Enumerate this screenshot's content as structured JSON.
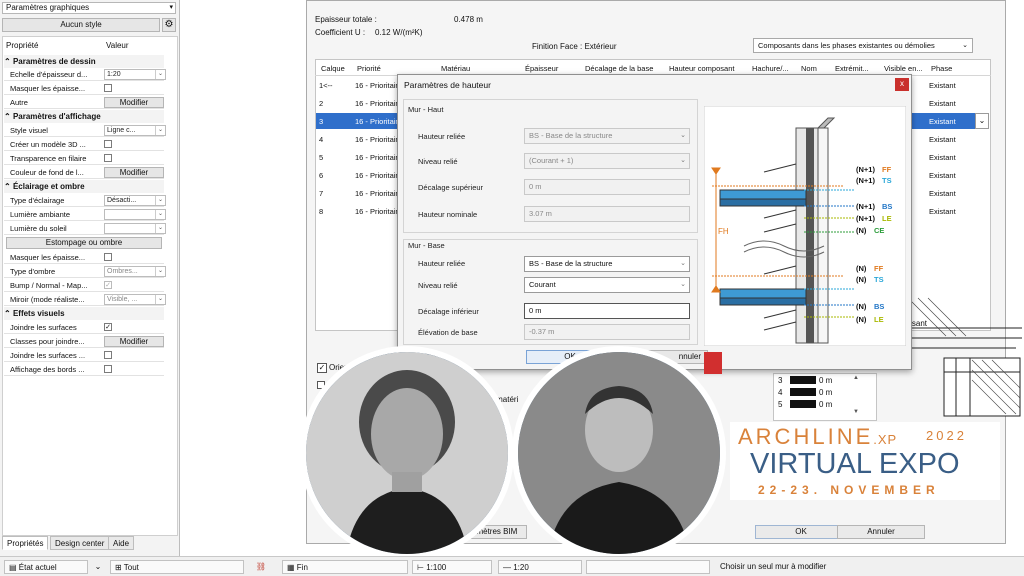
{
  "left_panel": {
    "dropdown": "Paramètres graphiques",
    "style_button": "Aucun style",
    "col_prop": "Propriété",
    "col_val": "Valeur",
    "sections": {
      "dessin": "Paramètres de dessin",
      "affichage": "Paramètres d'affichage",
      "eclairage": "Éclairage et ombre",
      "effets": "Effets visuels"
    },
    "rows": {
      "echelle": "Echelle d'épaisseur d...",
      "echelle_val": "1:20",
      "masquer1": "Masquer les épaisse...",
      "autre": "Autre",
      "modifier": "Modifier",
      "style_visuel": "Style visuel",
      "style_visuel_val": "Ligne c...",
      "creer_modele": "Créer un modèle 3D ...",
      "transparence": "Transparence en filaire",
      "couleur_fond": "Couleur de fond de l...",
      "type_eclairage": "Type d'éclairage",
      "type_eclairage_val": "Désacti...",
      "lumiere_ambiante": "Lumière ambiante",
      "lumiere_soleil": "Lumière du soleil",
      "estompage": "Estompage ou ombre",
      "masquer2": "Masquer les épaisse...",
      "type_ombre": "Type d'ombre",
      "type_ombre_val": "Ombres...",
      "bump": "Bump / Normal - Map...",
      "miroir": "Miroir (mode réaliste...",
      "miroir_val": "Visible, ...",
      "joindre": "Joindre les surfaces",
      "classes": "Classes pour joindre...",
      "joindre2": "Joindre les surfaces ...",
      "affichage_bords": "Affichage des bords ..."
    },
    "tabs": [
      "Propriétés",
      "Design center",
      "Aide"
    ]
  },
  "status_bar": {
    "etat": "État actuel",
    "tout": "Tout",
    "fin": "Fin",
    "scale1": "1:100",
    "scale2": "1:20",
    "hint": "Choisir un seul mur à modifier"
  },
  "main_dialog": {
    "epaisseur_label": "Epaisseur totale :",
    "epaisseur_val": "0.478 m",
    "coef_label": "Coefficient U :",
    "coef_val": "0.12 W/(m²K)",
    "finition": "Finition Face : Extérieur",
    "composants_dd": "Composants dans les phases existantes ou démolies",
    "headers": [
      "Calque",
      "Priorité",
      "Matériau",
      "Épaisseur",
      "Décalage de la base",
      "Hauteur composant",
      "Hachure/...",
      "Nom",
      "Extrémit...",
      "Visible en...",
      "Phase"
    ],
    "rows": [
      {
        "calque": "1<--",
        "prio": "16 - Prioritair",
        "phase": "Existant"
      },
      {
        "calque": "2",
        "prio": "16 - Prioritair",
        "phase": "Existant"
      },
      {
        "calque": "3",
        "prio": "16 - Prioritair",
        "phase": "Existant"
      },
      {
        "calque": "4",
        "prio": "16 - Prioritair",
        "phase": "Existant"
      },
      {
        "calque": "5",
        "prio": "16 - Prioritair",
        "phase": "Existant"
      },
      {
        "calque": "6",
        "prio": "16 - Prioritair",
        "phase": "Existant"
      },
      {
        "calque": "7",
        "prio": "16 - Prioritair",
        "phase": "Existant"
      },
      {
        "calque": "8",
        "prio": "16 - Prioritair",
        "phase": "Existant"
      }
    ],
    "posant": "posant",
    "orient": "Orient",
    "materi": "de matéri",
    "bim": "amètres BIM",
    "ok": "OK",
    "annuler": "Annuler",
    "small_table": [
      {
        "n": "3",
        "v": "0 m"
      },
      {
        "n": "4",
        "v": "0 m"
      },
      {
        "n": "5",
        "v": "0 m"
      }
    ]
  },
  "height_dialog": {
    "title": "Paramètres de hauteur",
    "close": "x",
    "haut_group": "Mur - Haut",
    "haut_hauteur_label": "Hauteur reliée",
    "haut_hauteur_val": "BS - Base de la structure",
    "haut_niveau_label": "Niveau relié",
    "haut_niveau_val": "(Courant + 1)",
    "decalage_sup_label": "Décalage supérieur",
    "decalage_sup_val": "0 m",
    "hauteur_nom_label": "Hauteur nominale",
    "hauteur_nom_val": "3.07 m",
    "base_group": "Mur - Base",
    "base_hauteur_label": "Hauteur reliée",
    "base_hauteur_val": "BS - Base de la structure",
    "base_niveau_label": "Niveau relié",
    "base_niveau_val": "Courant",
    "decalage_inf_label": "Décalage inférieur",
    "decalage_inf_val": "0 m",
    "elevation_label": "Élévation de base",
    "elevation_val": "-0.37 m",
    "ok": "OK",
    "annuler": "nnuler",
    "diagram": {
      "fh": "FH",
      "labels": [
        {
          "n": "(N+1)",
          "c": "FF",
          "col": "#e07a1f"
        },
        {
          "n": "(N+1)",
          "c": "TS",
          "col": "#2aa7d8"
        },
        {
          "n": "(N+1)",
          "c": "BS",
          "col": "#2176c7"
        },
        {
          "n": "(N+1)",
          "c": "LE",
          "col": "#a8b800"
        },
        {
          "n": "(N)",
          "c": "CE",
          "col": "#2c9c3a"
        },
        {
          "n": "(N)",
          "c": "FF",
          "col": "#e07a1f"
        },
        {
          "n": "(N)",
          "c": "TS",
          "col": "#2aa7d8"
        },
        {
          "n": "(N)",
          "c": "BS",
          "col": "#2176c7"
        },
        {
          "n": "(N)",
          "c": "LE",
          "col": "#a8b800"
        }
      ]
    }
  },
  "expo": {
    "brand_a": "ARCH",
    "brand_b": "LINE",
    "brand_c": ".XP",
    "year": "2022",
    "title": "VIRTUAL EXPO",
    "dates": "22-23. NOVEMBER"
  },
  "colors": {
    "selection": "#2f6fcb",
    "accent_blue": "#1d6fbf",
    "expo_orange": "#d9823a",
    "expo_blue": "#3a5e86"
  }
}
